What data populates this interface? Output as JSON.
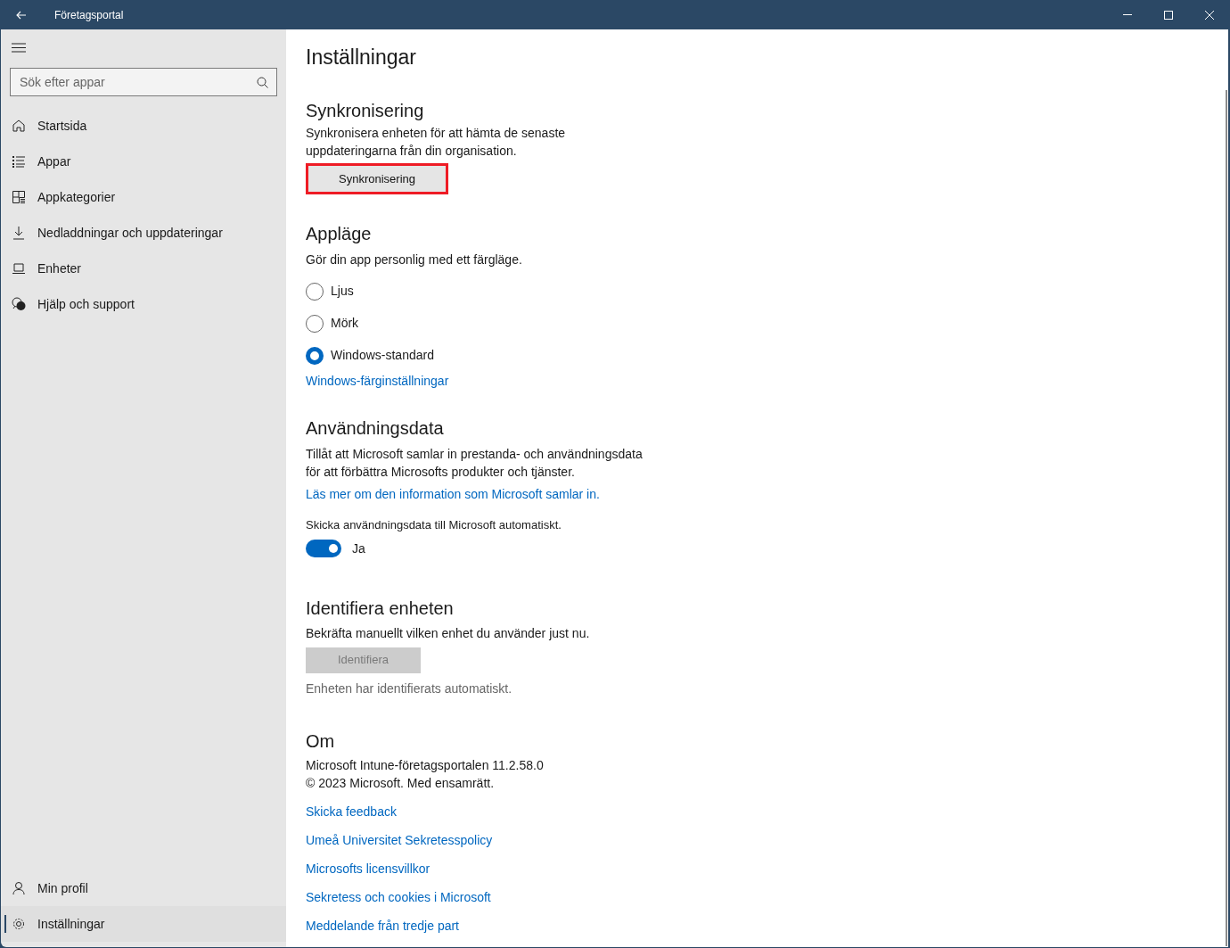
{
  "window": {
    "title": "Företagsportal"
  },
  "search": {
    "placeholder": "Sök efter appar"
  },
  "nav_items": [
    {
      "label": "Startsida",
      "selected": false
    },
    {
      "label": "Appar",
      "selected": false
    },
    {
      "label": "Appkategorier",
      "selected": false
    },
    {
      "label": "Nedladdningar och uppdateringar",
      "selected": false
    },
    {
      "label": "Enheter",
      "selected": false
    },
    {
      "label": "Hjälp och support",
      "selected": false
    }
  ],
  "nav_footer": [
    {
      "label": "Min profil",
      "selected": false
    },
    {
      "label": "Inställningar",
      "selected": true
    }
  ],
  "page_title": "Inställningar",
  "sync": {
    "heading": "Synkronisering",
    "description": "Synkronisera enheten för att hämta de senaste uppdateringarna från din organisation.",
    "button": "Synkronisering",
    "highlighted": true
  },
  "app_mode": {
    "heading": "Appläge",
    "description": "Gör din app personlig med ett färgläge.",
    "options": [
      {
        "label": "Ljus",
        "selected": false
      },
      {
        "label": "Mörk",
        "selected": false
      },
      {
        "label": "Windows-standard",
        "selected": true
      }
    ],
    "link": "Windows-färginställningar"
  },
  "usage_data": {
    "heading": "Användningsdata",
    "description": "Tillåt att Microsoft samlar in prestanda- och användningsdata för att förbättra Microsofts produkter och tjänster.",
    "link": "Läs mer om den information som Microsoft samlar in.",
    "toggle_label": "Skicka användningsdata till Microsoft automatiskt.",
    "toggle_on": true,
    "toggle_state": "Ja"
  },
  "identify": {
    "heading": "Identifiera enheten",
    "description": "Bekräfta manuellt vilken enhet du använder just nu.",
    "button": "Identifiera",
    "button_disabled": true,
    "status": "Enheten har identifierats automatiskt."
  },
  "about": {
    "heading": "Om",
    "version": "Microsoft Intune-företagsportalen 11.2.58.0",
    "copyright": "© 2023 Microsoft. Med ensamrätt.",
    "links": [
      "Skicka feedback",
      "Umeå Universitet Sekretesspolicy",
      "Microsofts licensvillkor",
      "Sekretess och cookies i Microsoft",
      "Meddelande från tredje part"
    ]
  }
}
